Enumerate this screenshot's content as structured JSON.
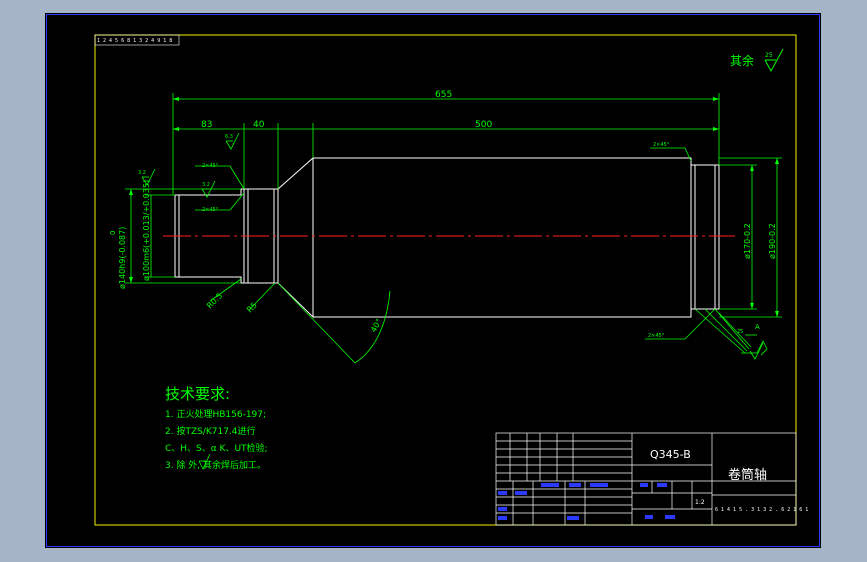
{
  "drawing": {
    "code_top_left": "1 2 4 5 6 8 1 3 2 4 9 1 8",
    "roughness_note": "其余",
    "roughness_value": "25",
    "dimensions": {
      "overall_length": "655",
      "left_length": "83",
      "shoulder_length": "40",
      "body_length": "500",
      "left_dia_1": "ø140h9(-0.087)",
      "left_dia_1_upper": "0",
      "left_dia_2": "ø100m6(+0.013/+0.035)",
      "right_dia_1": "ø170-0.2",
      "right_dia_2": "ø190-0.2",
      "radius_1": "R0.5",
      "radius_2": "R5",
      "angle": "40°",
      "chamfer": "2×45°",
      "roughness_small": "3.2",
      "roughness_small_2": "3.2",
      "roughness_small_3": "6.3",
      "roughness_right": "25",
      "datum": "A"
    },
    "tech_requirements": {
      "heading": "技术要求:",
      "items": [
        "1. 正火处理HB156-197;",
        "2. 按TZS/K717.4进行",
        "C、H、S、α K、UT检验;",
        "3. 除   外, 其余焊后加工。"
      ]
    },
    "title_block": {
      "material": "Q345-B",
      "part_name": "卷筒轴",
      "scale": "1:2",
      "drawing_number": "6 1 4 1 5 . 3 1 3 2 . 6 2 1 6 1"
    }
  },
  "colors": {
    "background": "#a6b4c8",
    "sheet": "#000000",
    "frame": "#f2f200",
    "outline": "#ffffff",
    "dimension": "#00ff00",
    "centerline": "#ff2020",
    "titleblock": "#ffffff"
  }
}
